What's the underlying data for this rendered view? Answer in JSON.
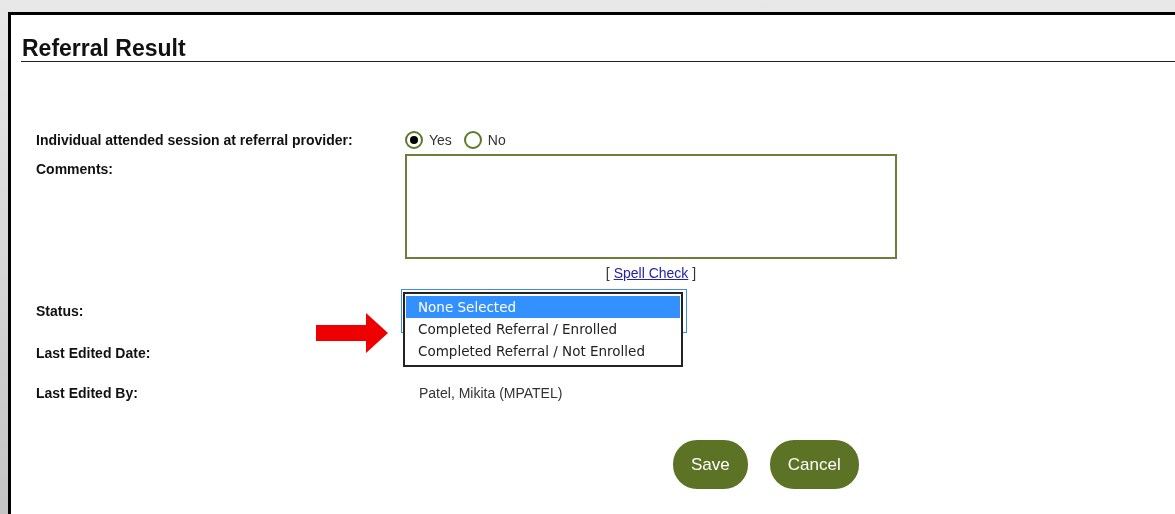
{
  "title": "Referral Result",
  "attended": {
    "label": "Individual attended session at referral provider:",
    "options": [
      {
        "label": "Yes",
        "selected": true
      },
      {
        "label": "No",
        "selected": false
      }
    ]
  },
  "comments": {
    "label": "Comments:"
  },
  "spell_check": {
    "before": "[",
    "link": "Spell Check",
    "after": "]"
  },
  "status": {
    "label": "Status:",
    "options": [
      {
        "label": "None Selected",
        "selected": true
      },
      {
        "label": "Completed Referral / Enrolled",
        "selected": false
      },
      {
        "label": "Completed Referral / Not Enrolled",
        "selected": false
      }
    ]
  },
  "last_edited_date": {
    "label": "Last Edited Date:"
  },
  "last_edited_by": {
    "label": "Last Edited By:",
    "value": "Patel, Mikita (MPATEL)"
  },
  "buttons": [
    {
      "label": "Save"
    },
    {
      "label": "Cancel"
    }
  ]
}
